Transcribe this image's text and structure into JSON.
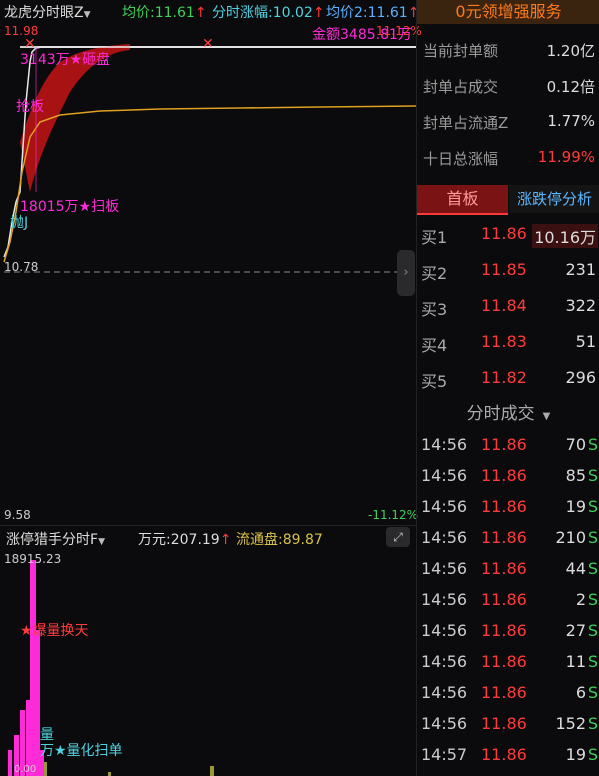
{
  "header": {
    "indicator_name": "龙虎分时眼Z",
    "avg_label": "均价:",
    "avg_value": "11.61",
    "chg_label": "分时涨幅:",
    "chg_value": "10.02",
    "avg2_label": "均价2:",
    "avg2_value": "11.61"
  },
  "chart_top": {
    "price_high": "11.98",
    "price_base": "10.78",
    "price_low": "9.58",
    "pct_low": "-11.12%",
    "pct_high": "11.12%",
    "label_gold": "金额",
    "label_gold_val": "3485.81万",
    "label_hit": "3143万★砸盘",
    "label_grab": "抢板",
    "label_sweep": "18015万★扫板",
    "label_dump": "抛J"
  },
  "bottom": {
    "indicator_name": "涨停猎手分时F",
    "amount_label": "万元:",
    "amount_value": "207.19",
    "float_label": "流通盘:",
    "float_value": "89.87",
    "vol_max": "18915.23",
    "label_burst": "★爆量换天",
    "label_vol": "量",
    "label_scan": "万★量化扫单",
    "label_zero": "0.00"
  },
  "right": {
    "promo": "0元领增强服务",
    "stats": [
      {
        "label": "当前封单额",
        "value": "1.20亿"
      },
      {
        "label": "封单占成交",
        "value": "0.12倍"
      },
      {
        "label": "封单占流通Z",
        "value": "1.77%"
      },
      {
        "label": "十日总涨幅",
        "value": "11.99%"
      }
    ],
    "tab_first": "首板",
    "tab_analysis": "涨跌停分析",
    "bids": [
      {
        "level": "买1",
        "price": "11.86",
        "vol": "10.16万"
      },
      {
        "level": "买2",
        "price": "11.85",
        "vol": "231"
      },
      {
        "level": "买3",
        "price": "11.84",
        "vol": "322"
      },
      {
        "level": "买4",
        "price": "11.83",
        "vol": "51"
      },
      {
        "level": "买5",
        "price": "11.82",
        "vol": "296"
      }
    ],
    "trades_title": "分时成交",
    "trades": [
      {
        "time": "14:56",
        "price": "11.86",
        "vol": "70",
        "side": "S"
      },
      {
        "time": "14:56",
        "price": "11.86",
        "vol": "85",
        "side": "S"
      },
      {
        "time": "14:56",
        "price": "11.86",
        "vol": "19",
        "side": "S"
      },
      {
        "time": "14:56",
        "price": "11.86",
        "vol": "210",
        "side": "S"
      },
      {
        "time": "14:56",
        "price": "11.86",
        "vol": "44",
        "side": "S"
      },
      {
        "time": "14:56",
        "price": "11.86",
        "vol": "2",
        "side": "S"
      },
      {
        "time": "14:56",
        "price": "11.86",
        "vol": "27",
        "side": "S"
      },
      {
        "time": "14:56",
        "price": "11.86",
        "vol": "11",
        "side": "S"
      },
      {
        "time": "14:56",
        "price": "11.86",
        "vol": "6",
        "side": "S"
      },
      {
        "time": "14:56",
        "price": "11.86",
        "vol": "152",
        "side": "S"
      },
      {
        "time": "14:57",
        "price": "11.86",
        "vol": "19",
        "side": "S"
      }
    ]
  }
}
